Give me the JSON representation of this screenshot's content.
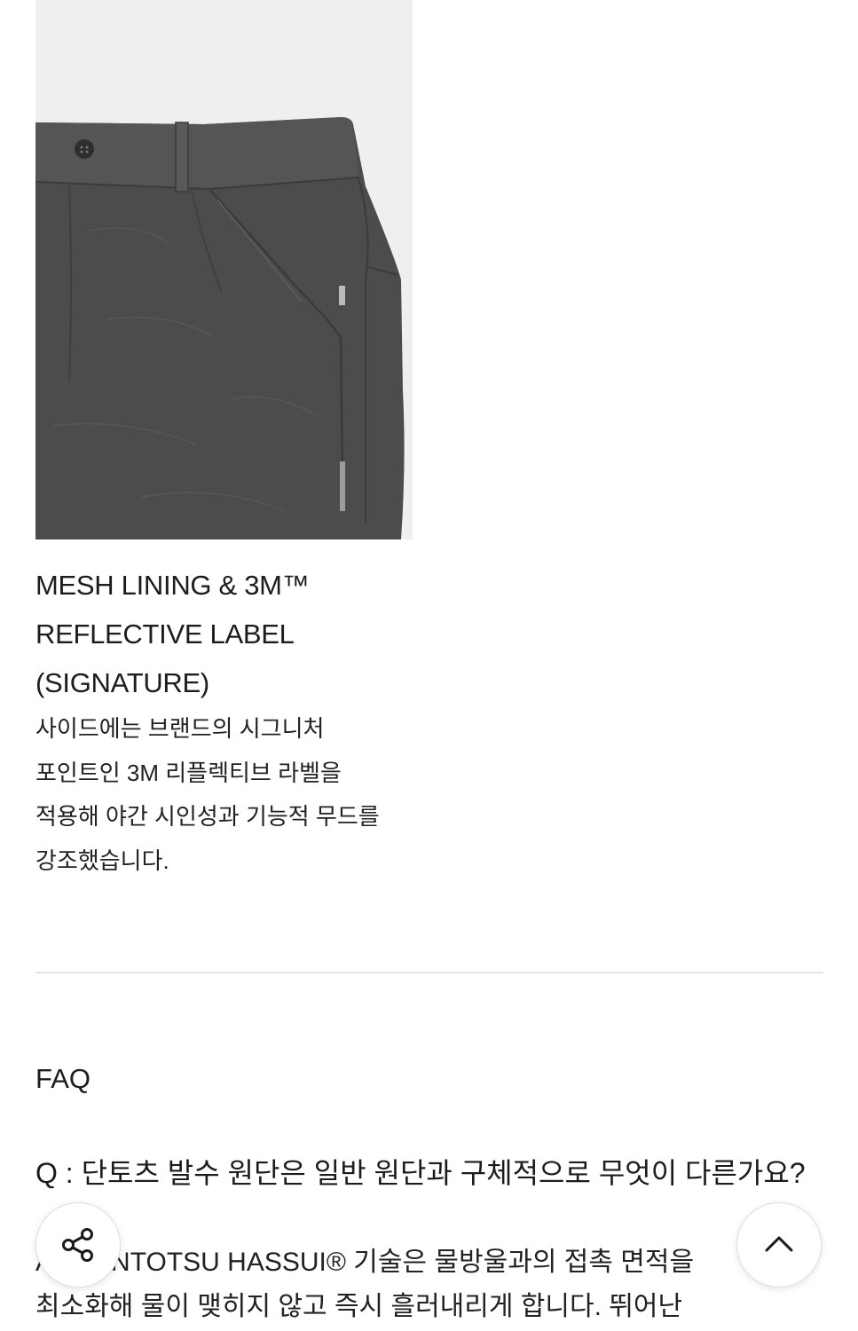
{
  "feature": {
    "title_lines": [
      "MESH LINING & 3M™",
      "REFLECTIVE LABEL",
      "(SIGNATURE)"
    ],
    "description_lines": [
      "사이드에는 브랜드의 시그니처",
      "포인트인 3M 리플렉티브 라벨을",
      "적용해 야간 시인성과 기능적 무드를",
      "강조했습니다."
    ]
  },
  "faq": {
    "heading": "FAQ",
    "question": "Q : 단토츠 발수 원단은 일반 원단과 구체적으로 무엇이 다른가요?",
    "answer_lines": [
      "A : DANTOTSU HASSUI® 기술은 물방울과의 접촉 면적을",
      "최소화해 물이 맺히지 않고 즉시 흘러내리게 합니다. 뛰어난"
    ]
  },
  "buttons": {
    "share_icon": "share-icon",
    "top_icon": "chevron-up-icon"
  },
  "colors": {
    "fabric": "#4a4d4c",
    "image_background": "#efefef",
    "divider": "#e4e4e4"
  }
}
